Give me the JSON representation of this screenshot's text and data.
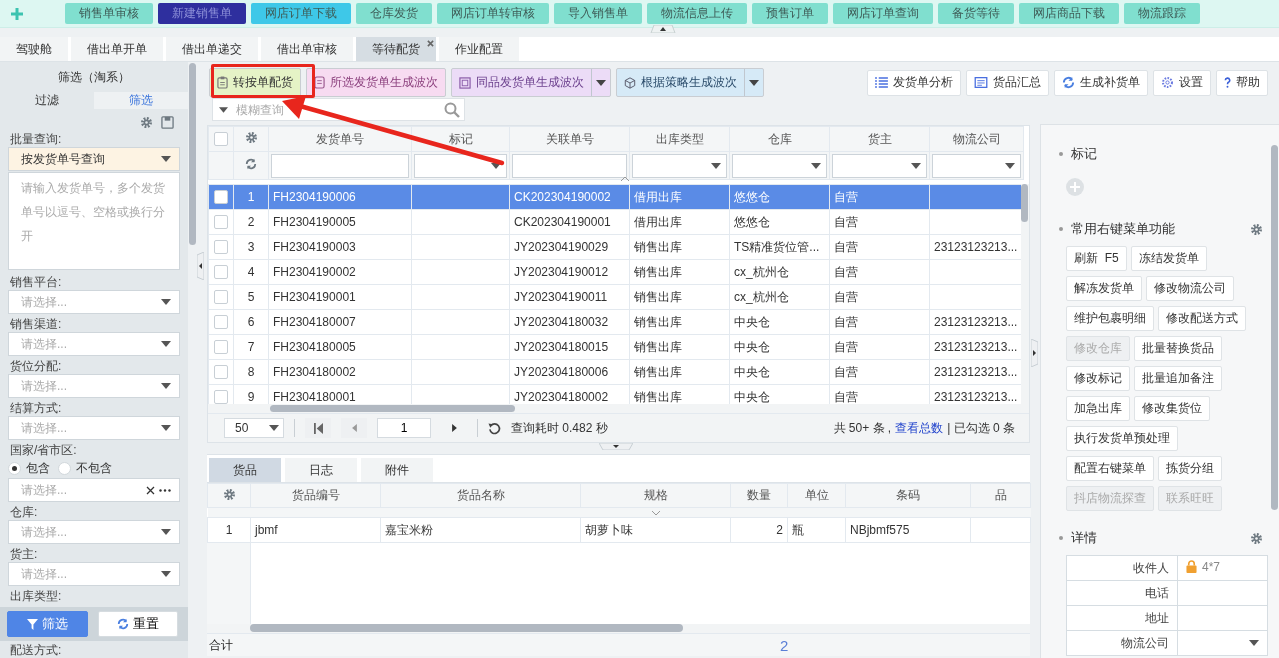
{
  "top_nav": {
    "items": [
      {
        "label": "销售单审核",
        "color": "#80dfcf"
      },
      {
        "label": "新建销售单",
        "color": "#2e2f9e"
      },
      {
        "label": "网店订单下载",
        "color": "#3ec8e8"
      },
      {
        "label": "仓库发货",
        "color": "#80dfcf"
      },
      {
        "label": "网店订单转审核",
        "color": "#80dfcf"
      },
      {
        "label": "导入销售单",
        "color": "#80dfcf"
      },
      {
        "label": "物流信息上传",
        "color": "#80dfcf"
      },
      {
        "label": "预售订单",
        "color": "#80dfcf"
      },
      {
        "label": "网店订单查询",
        "color": "#80dfcf"
      },
      {
        "label": "备货等待",
        "color": "#80dfcf"
      },
      {
        "label": "网店商品下载",
        "color": "#80dfcf"
      },
      {
        "label": "物流跟踪",
        "color": "#80dfcf"
      }
    ]
  },
  "tabs": [
    {
      "label": "驾驶舱",
      "selected": false,
      "closable": false
    },
    {
      "label": "借出单开单",
      "selected": false,
      "closable": false
    },
    {
      "label": "借出单递交",
      "selected": false,
      "closable": false
    },
    {
      "label": "借出单审核",
      "selected": false,
      "closable": false
    },
    {
      "label": "等待配货",
      "selected": true,
      "closable": true
    },
    {
      "label": "作业配置",
      "selected": false,
      "closable": false
    }
  ],
  "filter_panel": {
    "title": "筛选（淘系）",
    "tabs": [
      {
        "label": "过滤",
        "selected": false
      },
      {
        "label": "筛选",
        "selected": true
      }
    ],
    "fields": [
      {
        "kind": "batch",
        "label": "批量查询:",
        "value": "按发货单号查询",
        "placeholder": "请输入发货单号，多个发货单号以逗号、空格或换行分开"
      },
      {
        "kind": "select",
        "label": "销售平台:",
        "placeholder": "请选择..."
      },
      {
        "kind": "select",
        "label": "销售渠道:",
        "placeholder": "请选择..."
      },
      {
        "kind": "select",
        "label": "货位分配:",
        "placeholder": "请选择..."
      },
      {
        "kind": "select",
        "label": "结算方式:",
        "placeholder": "请选择..."
      },
      {
        "kind": "region",
        "label": "国家/省市区:",
        "placeholder": "请选择...",
        "options": [
          {
            "label": "包含",
            "selected": true
          },
          {
            "label": "不包含",
            "selected": false
          }
        ]
      },
      {
        "kind": "select",
        "label": "仓库:",
        "placeholder": "请选择..."
      },
      {
        "kind": "select",
        "label": "货主:",
        "placeholder": "请选择..."
      },
      {
        "kind": "label",
        "label": "出库类型:"
      },
      {
        "kind": "label",
        "label": "配送方式:"
      }
    ],
    "buttons": [
      {
        "label": "筛选",
        "kind": "primary"
      },
      {
        "label": "重置",
        "kind": "secondary"
      }
    ]
  },
  "toolbar": {
    "actions": [
      {
        "label": "转按单配货",
        "color": "#e5f3c6",
        "dropdown": false
      },
      {
        "label": "所选发货单生成波次",
        "color": "#f7dbf1",
        "dropdown": false
      },
      {
        "label": "同品发货单生成波次",
        "color": "#ecdcf7",
        "dropdown": true
      },
      {
        "label": "根据策略生成波次",
        "color": "#d6eaf7",
        "dropdown": true
      }
    ],
    "tools": [
      {
        "label": "发货单分析"
      },
      {
        "label": "货品汇总"
      },
      {
        "label": "生成补货单"
      },
      {
        "label": "设置"
      },
      {
        "label": "帮助"
      }
    ]
  },
  "search": {
    "placeholder": "模糊查询"
  },
  "shipments": {
    "all_checked": false,
    "columns": [
      "发货单号",
      "标记",
      "关联单号",
      "出库类型",
      "仓库",
      "货主",
      "物流公司"
    ],
    "rows": [
      {
        "no": "1",
        "checked": false,
        "selected": true,
        "shipment_no": "FH2304190006",
        "related_no": "CK202304190002",
        "out_type": "借用出库",
        "warehouse": "悠悠仓",
        "owner": "自营"
      },
      {
        "no": "2",
        "checked": false,
        "selected": false,
        "shipment_no": "FH2304190005",
        "related_no": "CK202304190001",
        "out_type": "借用出库",
        "warehouse": "悠悠仓",
        "owner": "自营"
      },
      {
        "no": "3",
        "checked": false,
        "selected": false,
        "shipment_no": "FH2304190003",
        "related_no": "JY202304190029",
        "out_type": "销售出库",
        "warehouse": "TS精准货位管...",
        "owner": "自营",
        "carrier": "23123123213..."
      },
      {
        "no": "4",
        "checked": false,
        "selected": false,
        "shipment_no": "FH2304190002",
        "related_no": "JY202304190012",
        "out_type": "销售出库",
        "warehouse": "cx_杭州仓",
        "owner": "自营"
      },
      {
        "no": "5",
        "checked": false,
        "selected": false,
        "shipment_no": "FH2304190001",
        "related_no": "JY202304190011",
        "out_type": "销售出库",
        "warehouse": "cx_杭州仓",
        "owner": "自营"
      },
      {
        "no": "6",
        "checked": false,
        "selected": false,
        "shipment_no": "FH2304180007",
        "related_no": "JY202304180032",
        "out_type": "销售出库",
        "warehouse": "中央仓",
        "owner": "自营",
        "carrier": "23123123213..."
      },
      {
        "no": "7",
        "checked": false,
        "selected": false,
        "shipment_no": "FH2304180005",
        "related_no": "JY202304180015",
        "out_type": "销售出库",
        "warehouse": "中央仓",
        "owner": "自营",
        "carrier": "23123123213..."
      },
      {
        "no": "8",
        "checked": false,
        "selected": false,
        "shipment_no": "FH2304180002",
        "related_no": "JY202304180006",
        "out_type": "销售出库",
        "warehouse": "中央仓",
        "owner": "自营",
        "carrier": "23123123213..."
      },
      {
        "no": "9",
        "checked": false,
        "selected": false,
        "shipment_no": "FH2304180001",
        "related_no": "JY202304180002",
        "out_type": "销售出库",
        "warehouse": "中央仓",
        "owner": "自营",
        "carrier": "23123123213..."
      }
    ]
  },
  "pager": {
    "page_size": "50",
    "page": "1",
    "elapsed": "查询耗时 0.482 秒",
    "total": "共 50+ 条 ,",
    "total_link": "查看总数",
    "checked_count": "| 已勾选 0 条"
  },
  "detail_tabs": [
    {
      "label": "货品",
      "selected": true
    },
    {
      "label": "日志",
      "selected": false
    },
    {
      "label": "附件",
      "selected": false
    }
  ],
  "items": {
    "columns": [
      "货品编号",
      "货品名称",
      "规格",
      "数量",
      "单位",
      "条码",
      "品"
    ],
    "rows": [
      {
        "no": "1",
        "cells": [
          "jbmf",
          "嘉宝米粉",
          "胡萝卜味",
          "2",
          "瓶",
          "NBjbmf575"
        ]
      }
    ],
    "total": {
      "label": "合计",
      "quantity": "2"
    }
  },
  "side_panel": {
    "marks": {
      "title": "标记"
    },
    "menu": {
      "title": "常用右键菜单功能",
      "buttons": [
        {
          "label": "刷新  F5",
          "disabled": false
        },
        {
          "label": "冻结发货单",
          "disabled": false
        },
        {
          "label": "解冻发货单",
          "disabled": false
        },
        {
          "label": "修改物流公司",
          "disabled": false
        },
        {
          "label": "维护包裹明细",
          "disabled": false
        },
        {
          "label": "修改配送方式",
          "disabled": false
        },
        {
          "label": "修改仓库",
          "disabled": true
        },
        {
          "label": "批量替换货品",
          "disabled": false
        },
        {
          "label": "修改标记",
          "disabled": false
        },
        {
          "label": "批量追加备注",
          "disabled": false
        },
        {
          "label": "加急出库",
          "disabled": false
        },
        {
          "label": "修改集货位",
          "disabled": false
        },
        {
          "label": "执行发货单预处理",
          "disabled": false
        },
        {
          "label": "配置右键菜单",
          "disabled": false
        },
        {
          "label": "拣货分组",
          "disabled": false
        },
        {
          "label": "抖店物流探查",
          "disabled": true
        },
        {
          "label": "联系旺旺",
          "disabled": true
        }
      ]
    },
    "details": {
      "title": "详情",
      "rows": [
        {
          "label": "收件人",
          "kind": "masked",
          "value": "4*7"
        },
        {
          "label": "电话",
          "kind": "text"
        },
        {
          "label": "地址",
          "kind": "text"
        },
        {
          "label": "物流公司",
          "kind": "select"
        }
      ]
    }
  }
}
